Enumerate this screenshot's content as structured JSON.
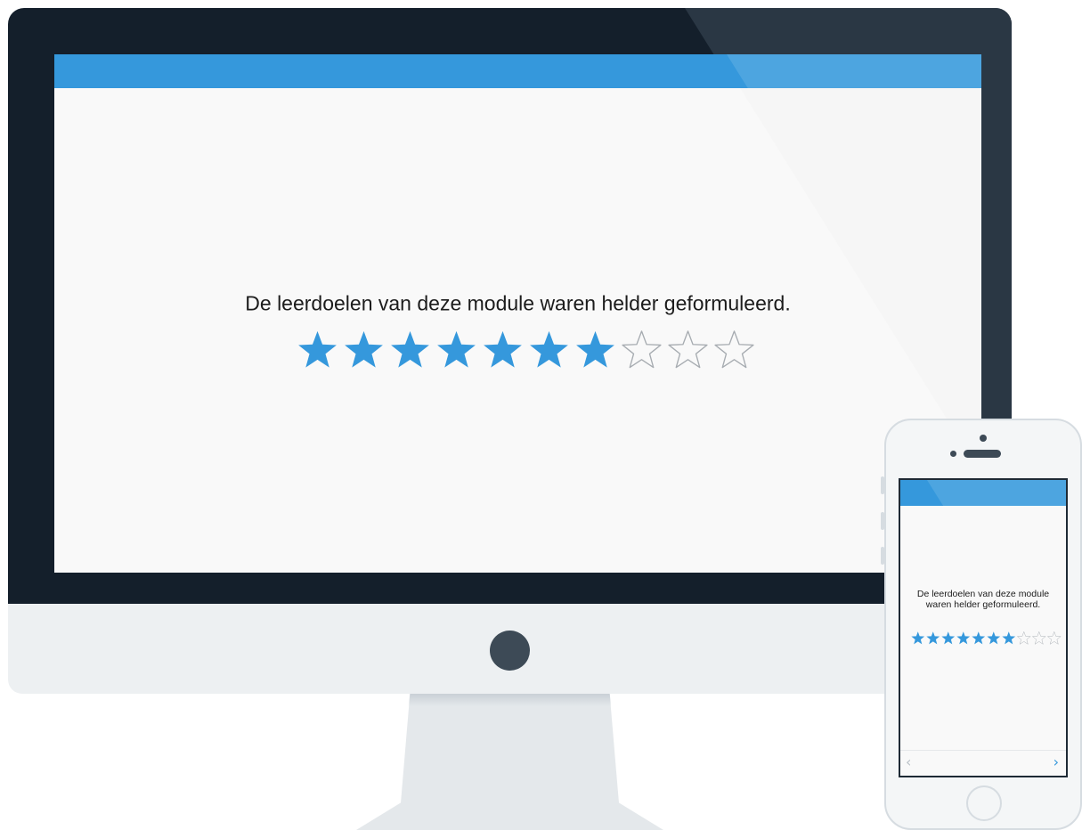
{
  "survey": {
    "question": "De leerdoelen van deze module waren helder geformuleerd.",
    "rating": {
      "value": 7,
      "max": 10
    },
    "phone_question": "De leerdoelen van deze module waren helder geformuleerd.",
    "nav": {
      "prev": "‹",
      "next": "›"
    }
  },
  "colors": {
    "accent": "#3598dc",
    "star_filled": "#3598dc",
    "star_empty_stroke": "#a7acb1",
    "bezel": "#141f2b",
    "screen": "#f9f9f9"
  },
  "icons": {
    "star_filled": "star-filled-icon",
    "star_empty": "star-empty-icon",
    "prev": "chevron-left-icon",
    "next": "chevron-right-icon"
  }
}
